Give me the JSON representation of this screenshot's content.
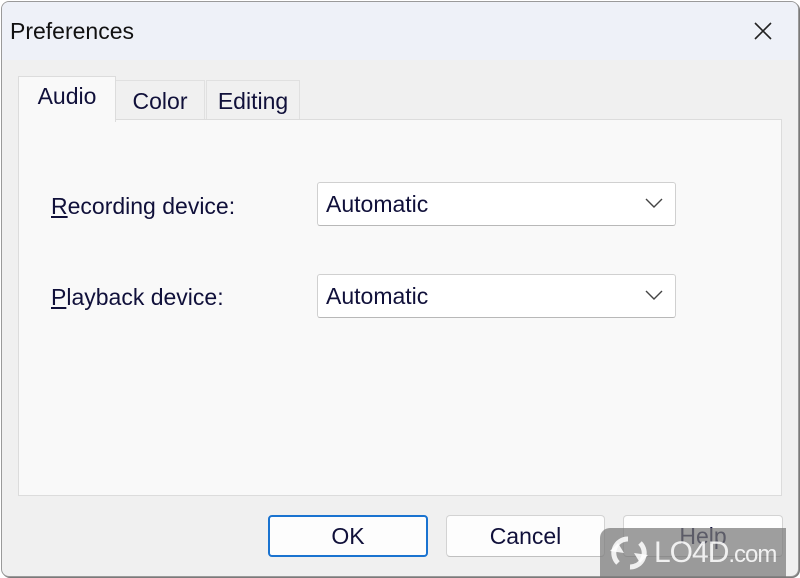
{
  "window": {
    "title": "Preferences"
  },
  "tabs": [
    {
      "label": "Audio",
      "active": true
    },
    {
      "label": "Color",
      "active": false
    },
    {
      "label": "Editing",
      "active": false
    }
  ],
  "audio": {
    "recording": {
      "label_mnemonic": "R",
      "label_rest": "ecording device:",
      "value": "Automatic"
    },
    "playback": {
      "label_mnemonic": "P",
      "label_rest": "layback device:",
      "value": "Automatic"
    }
  },
  "buttons": {
    "ok": "OK",
    "cancel": "Cancel",
    "help": "Help"
  },
  "colors": {
    "focus_accent": "#1a73d0",
    "titlebar": "#eef1f8"
  },
  "watermark": {
    "main": "LO4D",
    "suffix": ".com"
  }
}
